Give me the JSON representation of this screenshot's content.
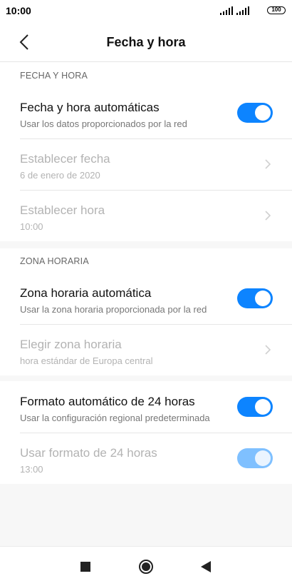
{
  "status": {
    "time": "10:00",
    "battery": "100",
    "icons": [
      "signal-icon",
      "signal-icon",
      "battery-icon"
    ]
  },
  "header": {
    "title": "Fecha y hora",
    "back_icon": "back-arrow-icon"
  },
  "sections": [
    {
      "label": "FECHA Y HORA",
      "rows": [
        {
          "title": "Fecha y hora automáticas",
          "subtitle": "Usar los datos proporcionados por la red",
          "control": "toggle-on"
        },
        {
          "title": "Establecer fecha",
          "subtitle": "6 de enero de 2020",
          "control": "chevron",
          "disabled": true
        },
        {
          "title": "Establecer hora",
          "subtitle": "10:00",
          "control": "chevron",
          "disabled": true
        }
      ]
    },
    {
      "label": "ZONA HORARIA",
      "rows": [
        {
          "title": "Zona horaria automática",
          "subtitle": "Usar la zona horaria proporcionada por la red",
          "control": "toggle-on"
        },
        {
          "title": "Elegir zona horaria",
          "subtitle": "hora estándar de Europa central",
          "control": "chevron",
          "disabled": true
        }
      ]
    },
    {
      "label": "",
      "rows": [
        {
          "title": "Formato automático de 24 horas",
          "subtitle": "Usar la configuración regional predeterminada",
          "control": "toggle-on"
        },
        {
          "title": "Usar formato de 24 horas",
          "subtitle": "13:00",
          "control": "toggle-on",
          "disabled": true
        }
      ]
    }
  ],
  "nav": {
    "icons": [
      "recent-apps-icon",
      "home-icon",
      "back-icon"
    ]
  },
  "colors": {
    "accent": "#0d84ff",
    "accent_disabled": "#7fc0ff",
    "background": "#f7f7f7"
  }
}
